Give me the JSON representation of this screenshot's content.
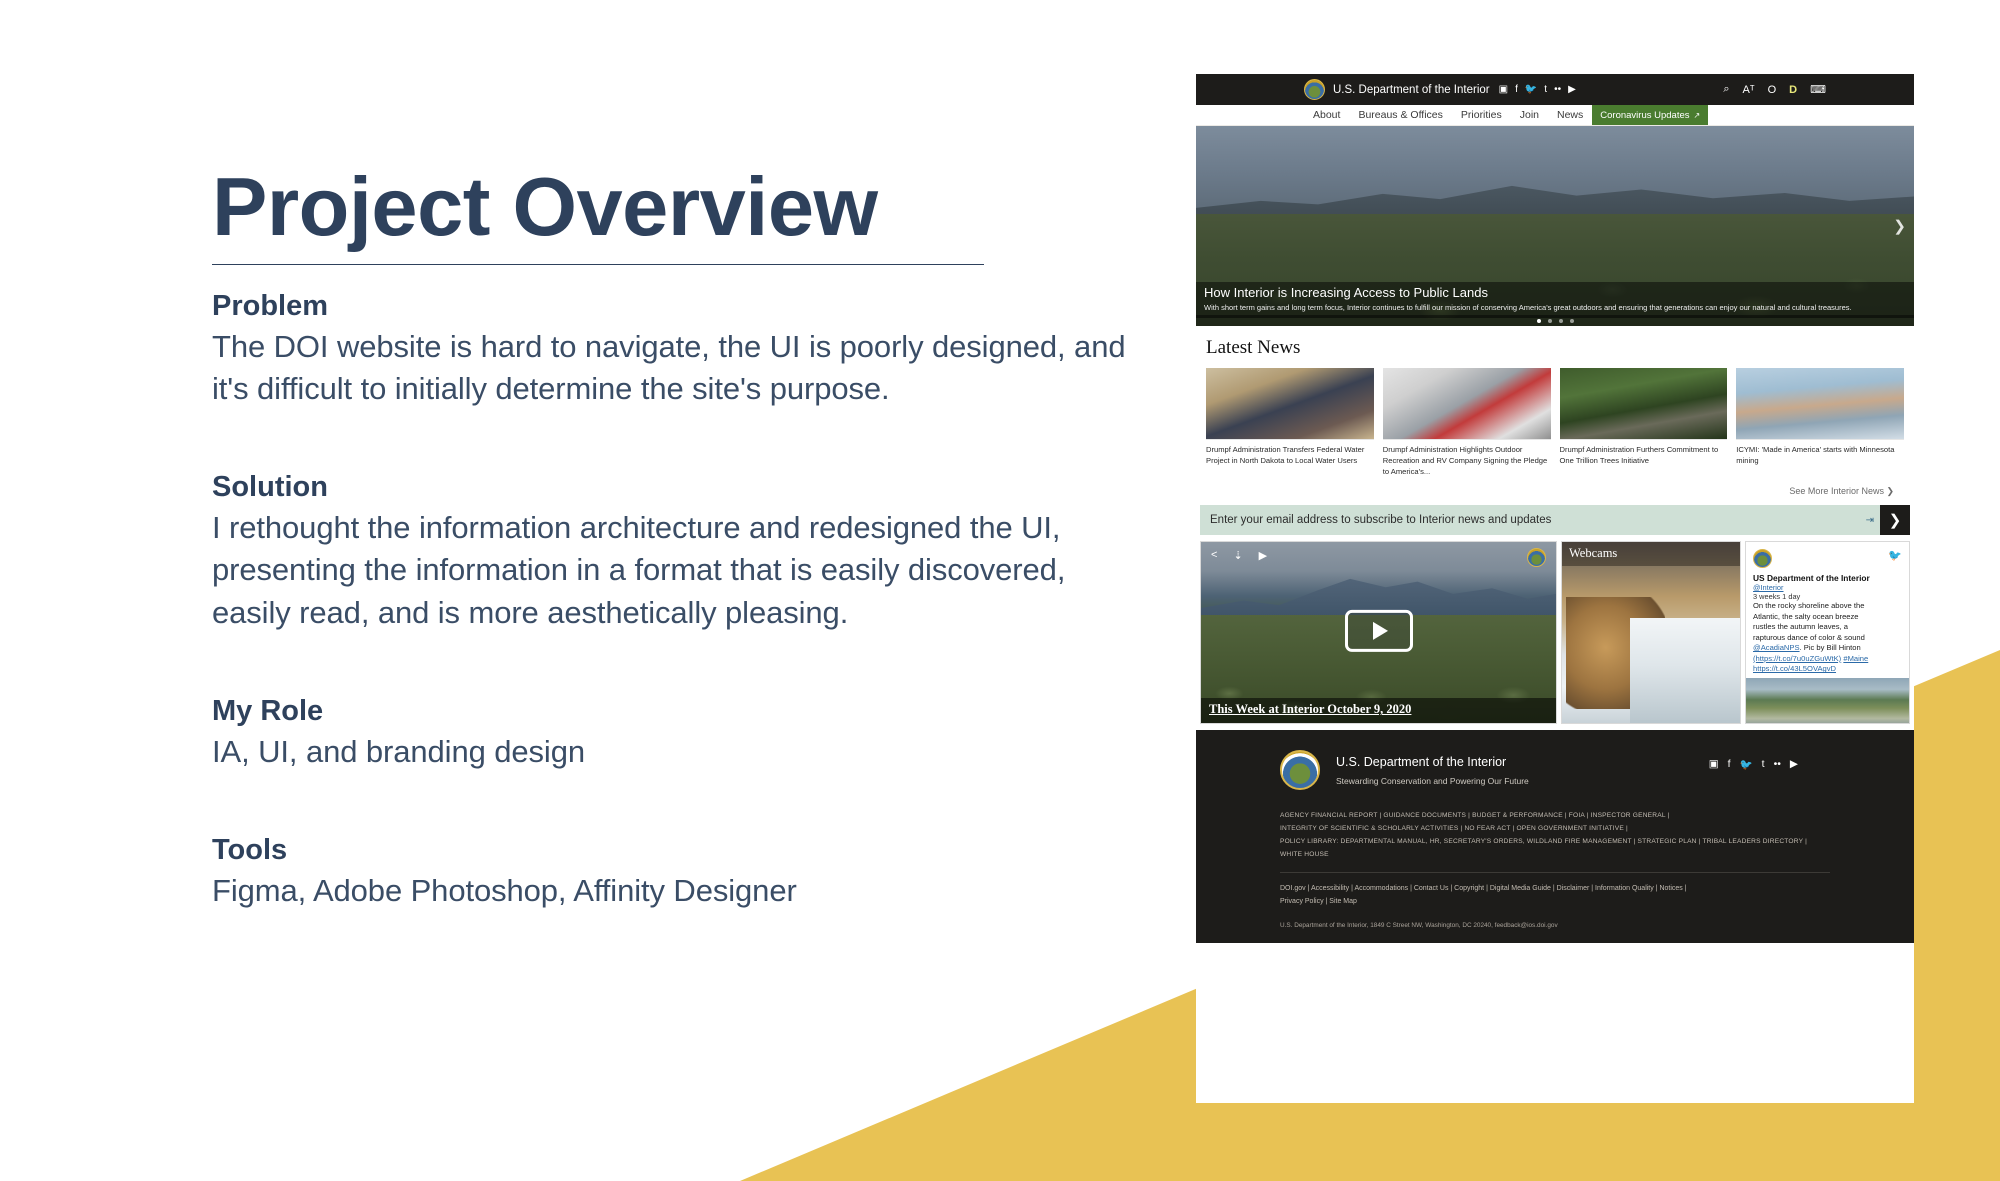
{
  "slide": {
    "title": "Project Overview",
    "sections": [
      {
        "heading": "Problem",
        "body": "The DOI website is hard to navigate, the UI is poorly designed, and it's difficult to initially determine the site's purpose."
      },
      {
        "heading": "Solution",
        "body": "I rethought the information architecture and redesigned the UI, presenting the information in a format that is easily discovered, easily read, and is more aesthetically pleasing."
      },
      {
        "heading": "My Role",
        "body": "IA, UI, and branding design"
      },
      {
        "heading": "Tools",
        "body": "Figma, Adobe Photoshop, Affinity Designer"
      }
    ],
    "accent_color": "#2e415c",
    "triangle_color": "#e8c254"
  },
  "mockup": {
    "topbar": {
      "brand": "U.S. Department of the Interior",
      "seal_icon": "doi-seal-icon",
      "social": [
        {
          "icon": "instagram-icon",
          "glyph": "▣"
        },
        {
          "icon": "facebook-icon",
          "glyph": "f"
        },
        {
          "icon": "twitter-icon",
          "glyph": "🐦"
        },
        {
          "icon": "tumblr-icon",
          "glyph": "t"
        },
        {
          "icon": "flickr-icon",
          "glyph": "••"
        },
        {
          "icon": "youtube-icon",
          "glyph": "▶"
        }
      ],
      "tools": [
        {
          "icon": "search-icon",
          "glyph": "⌕",
          "accent": false
        },
        {
          "icon": "font-size-icon",
          "glyph": "Aᵀ",
          "accent": false
        },
        {
          "icon": "contrast-icon",
          "glyph": "O",
          "accent": false
        },
        {
          "icon": "dyslexia-font-icon",
          "glyph": "D",
          "accent": true
        },
        {
          "icon": "keyboard-icon",
          "glyph": "⌨",
          "accent": false
        }
      ]
    },
    "nav": [
      {
        "label": "About",
        "highlight": false
      },
      {
        "label": "Bureaus & Offices",
        "highlight": false
      },
      {
        "label": "Priorities",
        "highlight": false
      },
      {
        "label": "Join",
        "highlight": false
      },
      {
        "label": "News",
        "highlight": false
      },
      {
        "label": "Coronavirus Updates",
        "highlight": true,
        "external_icon": "↗"
      }
    ],
    "nav_highlight_color": "#4a7c2f",
    "hero": {
      "title": "How Interior is Increasing Access to Public Lands",
      "subtitle": "With short term gains and long term focus, Interior continues to fulfill our mission of conserving America's great outdoors and ensuring that generations can enjoy our natural and cultural treasures.",
      "next_arrow_icon": "chevron-right-icon",
      "dot_count": 4,
      "active_dot": 1
    },
    "news": {
      "heading": "Latest News",
      "items": [
        {
          "title": "Drumpf Administration Transfers Federal Water Project in North Dakota to Local Water Users"
        },
        {
          "title": "Drumpf Administration Highlights Outdoor Recreation and RV Company Signing the Pledge to America's..."
        },
        {
          "title": "Drumpf Administration Furthers Commitment to One Trillion Trees Initiative"
        },
        {
          "title": "ICYMI: 'Made in America' starts with Minnesota mining"
        }
      ],
      "see_more": "See More Interior News ❯"
    },
    "subscribe": {
      "placeholder": "Enter your email address to subscribe to Interior news and updates",
      "submit_icon": "chevron-right-icon",
      "bg_color": "#cfe0d6"
    },
    "video": {
      "title": "This Week at Interior October 9, 2020",
      "icons": [
        {
          "icon": "share-icon",
          "glyph": "≺"
        },
        {
          "icon": "download-icon",
          "glyph": "⤓"
        },
        {
          "icon": "youtube-icon",
          "glyph": "▶"
        }
      ],
      "play_icon": "play-button-icon",
      "seal_icon": "doi-seal-icon"
    },
    "webcams": {
      "title": "Webcams"
    },
    "twitter": {
      "account_name": "US Department of the Interior",
      "handle": "@Interior",
      "timestamp": "3 weeks 1 day",
      "text_line1": "On the rocky shoreline above the",
      "text_line2": "Atlantic, the salty ocean breeze",
      "text_line3": "rustles the autumn leaves, a",
      "text_line4": "rapturous dance of color & sound",
      "mention": "@AcadiaNPS",
      "credit": ". Pic by Bill Hinton",
      "link1": "(https://t.co/7u0uZGuWtK)",
      "hashtag": "#Maine",
      "link2": "https://t.co/43L5OVAgvD",
      "bird_icon": "twitter-bird-icon",
      "avatar_icon": "doi-seal-avatar"
    },
    "footer": {
      "title": "U.S. Department of the Interior",
      "tagline": "Stewarding Conservation and Powering Our Future",
      "seal_icon": "doi-seal-icon",
      "social": [
        {
          "icon": "instagram-icon",
          "glyph": "▣"
        },
        {
          "icon": "facebook-icon",
          "glyph": "f"
        },
        {
          "icon": "twitter-icon",
          "glyph": "🐦"
        },
        {
          "icon": "tumblr-icon",
          "glyph": "t"
        },
        {
          "icon": "flickr-icon",
          "glyph": "••"
        },
        {
          "icon": "youtube-icon",
          "glyph": "▶"
        }
      ],
      "links_row1": "AGENCY FINANCIAL REPORT  |  GUIDANCE DOCUMENTS  |  BUDGET & PERFORMANCE  |  FOIA  |  INSPECTOR GENERAL  |",
      "links_row2": "INTEGRITY OF SCIENTIFIC & SCHOLARLY ACTIVITIES  |  NO FEAR ACT  |  OPEN GOVERNMENT INITIATIVE  |",
      "links_row3": "POLICY LIBRARY: DEPARTMENTAL MANUAL, HR, SECRETARY'S ORDERS, WILDLAND FIRE MANAGEMENT  |  STRATEGIC PLAN  |  TRIBAL LEADERS DIRECTORY  |",
      "links_row4": "WHITE HOUSE",
      "utility_row1": "DOI.gov  |   Accessibility   |   Accommodations   |   Contact Us   |   Copyright   |   Digital Media Guide   |   Disclaimer   |   Information Quality   |   Notices   |",
      "utility_row2": "Privacy Policy   |   Site Map",
      "address": "U.S. Department of the Interior, 1849 C Street NW, Washington, DC 20240, feedback@ios.doi.gov"
    }
  }
}
